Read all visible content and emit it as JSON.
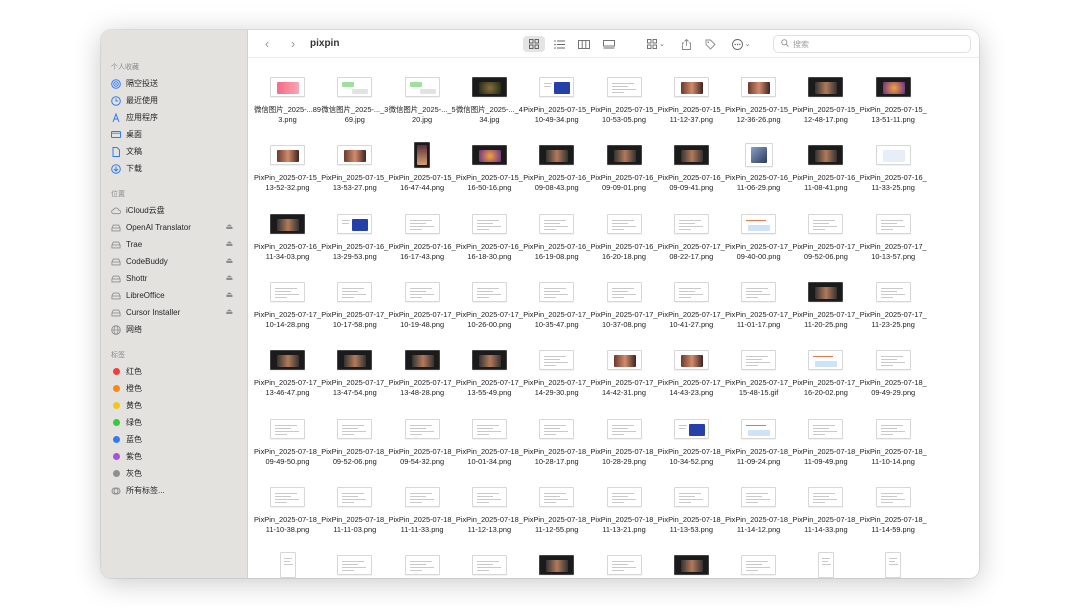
{
  "sidebar": {
    "favorites_title": "个人收藏",
    "favorites": [
      {
        "label": "隔空投送",
        "icon": "airdrop-icon"
      },
      {
        "label": "最近使用",
        "icon": "clock-icon"
      },
      {
        "label": "应用程序",
        "icon": "apps-icon"
      },
      {
        "label": "桌面",
        "icon": "desktop-icon"
      },
      {
        "label": "文稿",
        "icon": "document-icon"
      },
      {
        "label": "下载",
        "icon": "download-icon"
      }
    ],
    "locations_title": "位置",
    "locations": [
      {
        "label": "iCloud云盘",
        "icon": "cloud-icon",
        "eject": false
      },
      {
        "label": "OpenAI Translator",
        "icon": "disk-icon",
        "eject": true
      },
      {
        "label": "Trae",
        "icon": "disk-icon",
        "eject": true
      },
      {
        "label": "CodeBuddy",
        "icon": "disk-icon",
        "eject": true
      },
      {
        "label": "Shottr",
        "icon": "disk-icon",
        "eject": true
      },
      {
        "label": "LibreOffice",
        "icon": "disk-icon",
        "eject": true
      },
      {
        "label": "Cursor Installer",
        "icon": "disk-icon",
        "eject": true
      },
      {
        "label": "网络",
        "icon": "globe-icon",
        "eject": false
      }
    ],
    "tags_title": "标签",
    "tags": [
      {
        "label": "红色",
        "color": "#f23d3d"
      },
      {
        "label": "橙色",
        "color": "#f5871f"
      },
      {
        "label": "黄色",
        "color": "#f5c518"
      },
      {
        "label": "绿色",
        "color": "#38c93b"
      },
      {
        "label": "蓝色",
        "color": "#2f7bf5"
      },
      {
        "label": "紫色",
        "color": "#a652d9"
      },
      {
        "label": "灰色",
        "color": "#8e8e93"
      }
    ],
    "all_tags": "所有标签..."
  },
  "toolbar": {
    "title": "pixpin",
    "search_placeholder": "搜索"
  },
  "files": [
    {
      "name": "微信图片_2025-...893.png",
      "thumb": "pink"
    },
    {
      "name": "微信图片_2025-..._369.jpg",
      "thumb": "chat"
    },
    {
      "name": "微信图片_2025-..._520.jpg",
      "thumb": "chat"
    },
    {
      "name": "微信图片_2025-..._434.jpg",
      "thumb": "photo"
    },
    {
      "name": "PixPin_2025-07-15_10-49-34.png",
      "thumb": "blue"
    },
    {
      "name": "PixPin_2025-07-15_10-53-05.png",
      "thumb": "doc"
    },
    {
      "name": "PixPin_2025-07-15_11-12-37.png",
      "thumb": "people"
    },
    {
      "name": "PixPin_2025-07-15_12-36-26.png",
      "thumb": "people"
    },
    {
      "name": "PixPin_2025-07-15_12-48-17.png",
      "thumb": "dark"
    },
    {
      "name": "PixPin_2025-07-15_13-51-11.png",
      "thumb": "warm"
    },
    {
      "name": "PixPin_2025-07-15_13-52-32.png",
      "thumb": "people"
    },
    {
      "name": "PixPin_2025-07-15_13-53-27.png",
      "thumb": "people"
    },
    {
      "name": "PixPin_2025-07-15_16-47-44.png",
      "thumb": "tallphoto"
    },
    {
      "name": "PixPin_2025-07-15_16-50-16.png",
      "thumb": "warm"
    },
    {
      "name": "PixPin_2025-07-16_09-08-43.png",
      "thumb": "dark"
    },
    {
      "name": "PixPin_2025-07-16_09-09-01.png",
      "thumb": "dark"
    },
    {
      "name": "PixPin_2025-07-16_09-09-41.png",
      "thumb": "dark"
    },
    {
      "name": "PixPin_2025-07-16_11-06-29.png",
      "thumb": "phone"
    },
    {
      "name": "PixPin_2025-07-16_11-08-41.png",
      "thumb": "dark"
    },
    {
      "name": "PixPin_2025-07-16_11-33-25.png",
      "thumb": "light"
    },
    {
      "name": "PixPin_2025-07-16_11-34-03.png",
      "thumb": "dark"
    },
    {
      "name": "PixPin_2025-07-16_13-29-53.png",
      "thumb": "blue"
    },
    {
      "name": "PixPin_2025-07-16_16-17-43.png",
      "thumb": "doc"
    },
    {
      "name": "PixPin_2025-07-16_16-18-30.png",
      "thumb": "doc"
    },
    {
      "name": "PixPin_2025-07-16_16-19-08.png",
      "thumb": "doc"
    },
    {
      "name": "PixPin_2025-07-16_16-20-18.png",
      "thumb": "doc"
    },
    {
      "name": "PixPin_2025-07-17_08-22-17.png",
      "thumb": "doc"
    },
    {
      "name": "PixPin_2025-07-17_09-40-00.png",
      "thumb": "chart"
    },
    {
      "name": "PixPin_2025-07-17_09-52-06.png",
      "thumb": "doc"
    },
    {
      "name": "PixPin_2025-07-17_10-13-57.png",
      "thumb": "doc"
    },
    {
      "name": "PixPin_2025-07-17_10-14-28.png",
      "thumb": "doc"
    },
    {
      "name": "PixPin_2025-07-17_10-17-58.png",
      "thumb": "doc"
    },
    {
      "name": "PixPin_2025-07-17_10-19-48.png",
      "thumb": "doc"
    },
    {
      "name": "PixPin_2025-07-17_10-26-00.png",
      "thumb": "doc"
    },
    {
      "name": "PixPin_2025-07-17_10-35-47.png",
      "thumb": "doc"
    },
    {
      "name": "PixPin_2025-07-17_10-37-08.png",
      "thumb": "doc"
    },
    {
      "name": "PixPin_2025-07-17_10-41-27.png",
      "thumb": "doc"
    },
    {
      "name": "PixPin_2025-07-17_11-01-17.png",
      "thumb": "doc"
    },
    {
      "name": "PixPin_2025-07-17_11-20-25.png",
      "thumb": "dark"
    },
    {
      "name": "PixPin_2025-07-17_11-23-25.png",
      "thumb": "doc"
    },
    {
      "name": "PixPin_2025-07-17_13-46-47.png",
      "thumb": "dark"
    },
    {
      "name": "PixPin_2025-07-17_13-47-54.png",
      "thumb": "dark"
    },
    {
      "name": "PixPin_2025-07-17_13-48-28.png",
      "thumb": "dark"
    },
    {
      "name": "PixPin_2025-07-17_13-55-49.png",
      "thumb": "dark"
    },
    {
      "name": "PixPin_2025-07-17_14-29-30.png",
      "thumb": "doc"
    },
    {
      "name": "PixPin_2025-07-17_14-42-31.png",
      "thumb": "people"
    },
    {
      "name": "PixPin_2025-07-17_14-43-23.png",
      "thumb": "people"
    },
    {
      "name": "PixPin_2025-07-17_15-48-15.gif",
      "thumb": "doc"
    },
    {
      "name": "PixPin_2025-07-17_16-20-02.png",
      "thumb": "chart"
    },
    {
      "name": "PixPin_2025-07-18_09-49-29.png",
      "thumb": "doc"
    },
    {
      "name": "PixPin_2025-07-18_09-49-50.png",
      "thumb": "doc"
    },
    {
      "name": "PixPin_2025-07-18_09-52-06.png",
      "thumb": "doc"
    },
    {
      "name": "PixPin_2025-07-18_09-54-32.png",
      "thumb": "doc"
    },
    {
      "name": "PixPin_2025-07-18_10-01-34.png",
      "thumb": "doc"
    },
    {
      "name": "PixPin_2025-07-18_10-28-17.png",
      "thumb": "doc"
    },
    {
      "name": "PixPin_2025-07-18_10-28-29.png",
      "thumb": "doc"
    },
    {
      "name": "PixPin_2025-07-18_10-34-52.png",
      "thumb": "blue"
    },
    {
      "name": "PixPin_2025-07-18_11-09-24.png",
      "thumb": "chart"
    },
    {
      "name": "PixPin_2025-07-18_11-09-49.png",
      "thumb": "doc"
    },
    {
      "name": "PixPin_2025-07-18_11-10-14.png",
      "thumb": "doc"
    },
    {
      "name": "PixPin_2025-07-18_11-10-38.png",
      "thumb": "doc"
    },
    {
      "name": "PixPin_2025-07-18_11-11-03.png",
      "thumb": "doc"
    },
    {
      "name": "PixPin_2025-07-18_11-11-33.png",
      "thumb": "doc"
    },
    {
      "name": "PixPin_2025-07-18_11-12-13.png",
      "thumb": "doc"
    },
    {
      "name": "PixPin_2025-07-18_11-12-55.png",
      "thumb": "doc"
    },
    {
      "name": "PixPin_2025-07-18_11-13-21.png",
      "thumb": "doc"
    },
    {
      "name": "PixPin_2025-07-18_11-13-53.png",
      "thumb": "doc"
    },
    {
      "name": "PixPin_2025-07-18_11-14-12.png",
      "thumb": "doc"
    },
    {
      "name": "PixPin_2025-07-18_11-14-33.png",
      "thumb": "doc"
    },
    {
      "name": "PixPin_2025-07-18_11-14-59.png",
      "thumb": "doc"
    },
    {
      "name": "",
      "thumb": "tall"
    },
    {
      "name": "",
      "thumb": "doc"
    },
    {
      "name": "",
      "thumb": "doc"
    },
    {
      "name": "",
      "thumb": "doc"
    },
    {
      "name": "",
      "thumb": "dark"
    },
    {
      "name": "",
      "thumb": "doc"
    },
    {
      "name": "",
      "thumb": "dark"
    },
    {
      "name": "",
      "thumb": "doc"
    },
    {
      "name": "",
      "thumb": "tall"
    },
    {
      "name": "",
      "thumb": "tall"
    }
  ]
}
